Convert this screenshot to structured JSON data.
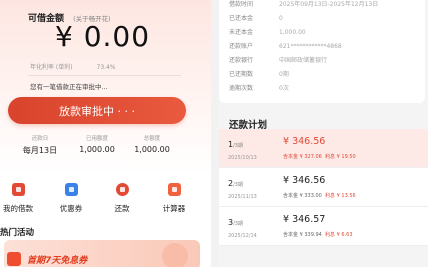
{
  "left": {
    "credit_title": "可借金额",
    "credit_note": "关于畅开花",
    "amount": "¥ 0.00",
    "rate_label": "年化利率 (单利)",
    "rate_value": "73.4%",
    "pending_note": "您有一笔借款正在审批中...",
    "release_button": "放款审批中 · · ·",
    "stats": [
      {
        "label": "还款日",
        "value": "每月13日"
      },
      {
        "label": "已用额度",
        "value": "1,000.00"
      },
      {
        "label": "总额度",
        "value": "1,000.00"
      }
    ],
    "quick_actions": [
      {
        "label": "我的借款"
      },
      {
        "label": "优惠券"
      },
      {
        "label": "还款"
      },
      {
        "label": "计算器"
      }
    ],
    "activity_title": "热门活动",
    "promo_text": "首期7天免息券"
  },
  "right": {
    "info_rows": [
      {
        "label": "借款时间",
        "value": "2025年09月13日-2025年12月13日"
      },
      {
        "label": "已还本金",
        "value": "0"
      },
      {
        "label": "未还本金",
        "value": "1,000.00"
      },
      {
        "label": "还款账户",
        "value": "621************4868"
      },
      {
        "label": "还款银行",
        "value": "中国邮政储蓄银行"
      },
      {
        "label": "已还期数",
        "value": "0期"
      },
      {
        "label": "逾期次数",
        "value": "0次"
      }
    ],
    "plan_title": "还款计划",
    "plan": [
      {
        "num": "1",
        "total": "/3期",
        "date": "2025/10/13",
        "amount": "¥ 346.56",
        "principal": "含本金 ¥ 327.06",
        "interest": "利息 ¥ 19.50"
      },
      {
        "num": "2",
        "total": "/3期",
        "date": "2025/11/13",
        "amount": "¥ 346.56",
        "principal": "含本金 ¥ 333.00",
        "interest": "利息 ¥ 13.56"
      },
      {
        "num": "3",
        "total": "/3期",
        "date": "2025/12/14",
        "amount": "¥ 346.57",
        "principal": "含本金 ¥ 339.94",
        "interest": "利息 ¥ 6.63"
      }
    ]
  },
  "colors": {
    "accent": "#e24a36",
    "button_gradient_start": "#d8432c",
    "button_gradient_end": "#e95a3e",
    "current_row_bg": "#fde9e6",
    "coupon_blue": "#3a82e8"
  },
  "icons": {
    "my_loans": "document-icon",
    "coupons": "coupon-icon",
    "repay": "repay-icon",
    "calculator": "calculator-icon"
  }
}
